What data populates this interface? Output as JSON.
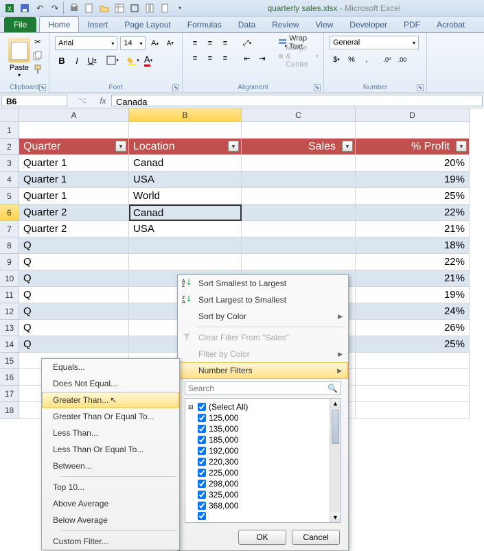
{
  "title": {
    "filename": "quarterly sales.xlsx",
    "app": "Microsoft Excel"
  },
  "tabs": {
    "file": "File",
    "home": "Home",
    "insert": "Insert",
    "pagelayout": "Page Layout",
    "formulas": "Formulas",
    "data": "Data",
    "review": "Review",
    "view": "View",
    "developer": "Developer",
    "pdf": "PDF",
    "acrobat": "Acrobat"
  },
  "ribbon": {
    "clipboard": {
      "label": "Clipboard",
      "paste": "Paste"
    },
    "font": {
      "label": "Font",
      "name": "Arial",
      "size": "14"
    },
    "alignment": {
      "label": "Alignment",
      "wrap": "Wrap Text",
      "merge": "Merge & Center"
    },
    "number": {
      "label": "Number",
      "format": "General"
    }
  },
  "namebox": "B6",
  "formula": "Canada",
  "cols": [
    "A",
    "B",
    "C",
    "D"
  ],
  "headers": {
    "a": "Quarter",
    "b": "Location",
    "c": "Sales",
    "d": "% Profit"
  },
  "rows": [
    {
      "n": "3",
      "a": "Quarter 1",
      "b": "Canad",
      "d": "20%",
      "band": false
    },
    {
      "n": "4",
      "a": "Quarter 1",
      "b": "USA",
      "d": "19%",
      "band": true
    },
    {
      "n": "5",
      "a": "Quarter 1",
      "b": "World",
      "d": "25%",
      "band": false
    },
    {
      "n": "6",
      "a": "Quarter 2",
      "b": "Canad",
      "d": "22%",
      "band": true,
      "active": true,
      "sel": true
    },
    {
      "n": "7",
      "a": "Quarter 2",
      "b": "USA",
      "d": "21%",
      "band": false
    },
    {
      "n": "8",
      "a": "Q",
      "b": "",
      "d": "18%",
      "band": true
    },
    {
      "n": "9",
      "a": "Q",
      "b": "",
      "d": "22%",
      "band": false
    },
    {
      "n": "10",
      "a": "Q",
      "b": "",
      "d": "21%",
      "band": true
    },
    {
      "n": "11",
      "a": "Q",
      "b": "",
      "d": "19%",
      "band": false
    },
    {
      "n": "12",
      "a": "Q",
      "b": "",
      "d": "24%",
      "band": true
    },
    {
      "n": "13",
      "a": "Q",
      "b": "",
      "d": "26%",
      "band": false
    },
    {
      "n": "14",
      "a": "Q",
      "b": "",
      "d": "25%",
      "band": true
    }
  ],
  "filter_menu": {
    "sort_asc": "Sort Smallest to Largest",
    "sort_desc": "Sort Largest to Smallest",
    "sort_color": "Sort by Color",
    "clear": "Clear Filter From \"Sales\"",
    "filter_color": "Filter by Color",
    "number_filters": "Number Filters",
    "search_placeholder": "Search",
    "select_all": "(Select All)",
    "values": [
      "125,000",
      "135,000",
      "185,000",
      "192,000",
      "220,300",
      "225,000",
      "298,000",
      "325,000",
      "368,000"
    ],
    "ok": "OK",
    "cancel": "Cancel"
  },
  "submenu": {
    "equals": "Equals...",
    "not_equal": "Does Not Equal...",
    "greater": "Greater Than...",
    "gte": "Greater Than Or Equal To...",
    "less": "Less Than...",
    "lte": "Less Than Or Equal To...",
    "between": "Between...",
    "top10": "Top 10...",
    "above_avg": "Above Average",
    "below_avg": "Below Average",
    "custom": "Custom Filter..."
  }
}
